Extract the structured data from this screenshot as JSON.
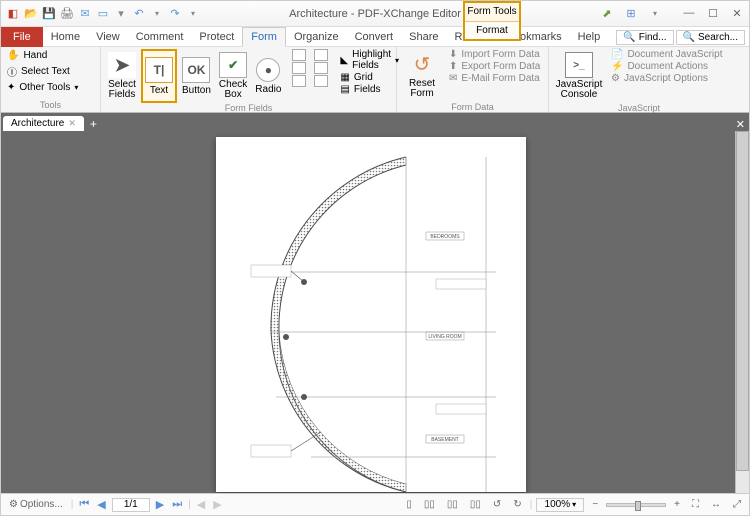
{
  "title": "Architecture - PDF-XChange Editor",
  "form_tools_box": {
    "top": "Form Tools",
    "bottom": "Format"
  },
  "menubar": {
    "file": "File",
    "items": [
      "Home",
      "View",
      "Comment",
      "Protect",
      "Form",
      "Organize",
      "Convert",
      "Share",
      "Review",
      "Bookmarks",
      "Help"
    ],
    "active": "Form",
    "find": "Find...",
    "search": "Search..."
  },
  "ribbon": {
    "tools_group": "Tools",
    "tools": {
      "hand": "Hand",
      "select_text": "Select Text",
      "other_tools": "Other Tools"
    },
    "select_fields": "Select\nFields",
    "text": "Text",
    "button": "Button",
    "button_ico": "OK",
    "checkbox": "Check\nBox",
    "radio": "Radio",
    "ff_tools": {
      "highlight": "Highlight Fields",
      "grid": "Grid",
      "fields": "Fields"
    },
    "ff_label": "Form Fields",
    "reset_form": "Reset\nForm",
    "form_data": {
      "import": "Import Form Data",
      "export": "Export Form Data",
      "email": "E-Mail Form Data"
    },
    "fd_label": "Form Data",
    "js_console": "JavaScript\nConsole",
    "js_opts": {
      "doc": "Document JavaScript",
      "actions": "Document Actions",
      "options": "JavaScript Options"
    },
    "js_label": "JavaScript"
  },
  "doc_tab": "Architecture",
  "drawing_labels": {
    "bedrooms": "BEDROOMS",
    "living": "LIVING ROOM",
    "basement": "BASEMENT"
  },
  "statusbar": {
    "options": "Options...",
    "page": "1/1",
    "zoom": "100%"
  }
}
